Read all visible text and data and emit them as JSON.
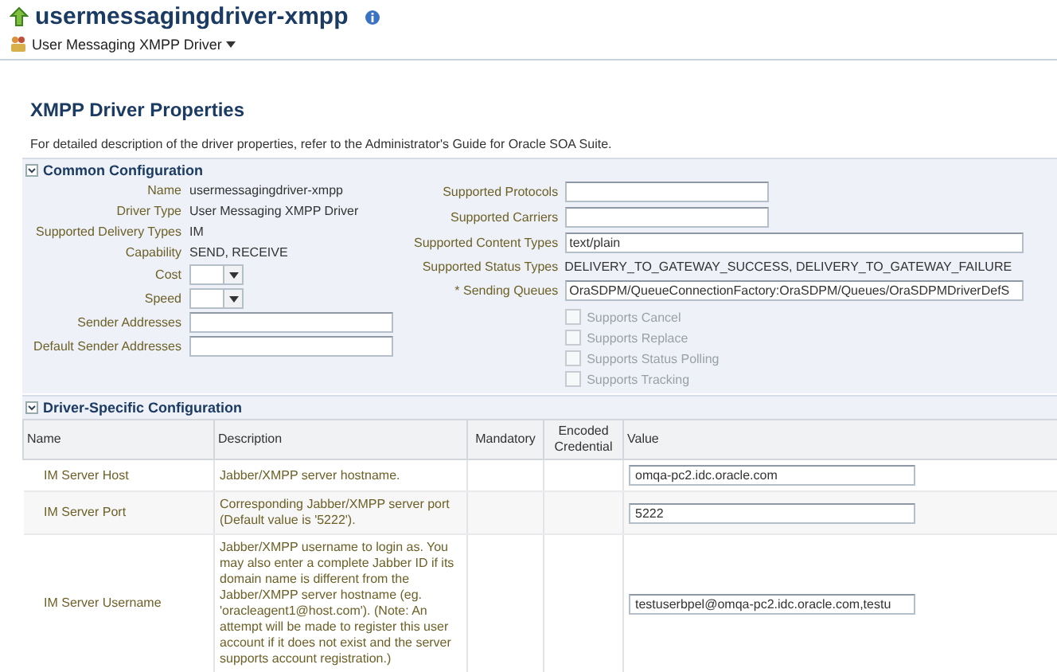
{
  "page": {
    "title": "usermessagingdriver-xmpp",
    "menu": "User Messaging XMPP Driver"
  },
  "heading": "XMPP Driver Properties",
  "description": "For detailed description of the driver properties, refer to the Administrator's Guide for Oracle SOA Suite.",
  "common": {
    "title": "Common Configuration",
    "expanded": true,
    "left": [
      {
        "kind": "text",
        "label": "Name",
        "value": "usermessagingdriver-xmpp"
      },
      {
        "kind": "text",
        "label": "Driver Type",
        "value": "User Messaging XMPP Driver"
      },
      {
        "kind": "text",
        "label": "Supported Delivery Types",
        "value": "IM"
      },
      {
        "kind": "text",
        "label": "Capability",
        "value": "SEND, RECEIVE"
      },
      {
        "kind": "select",
        "label": "Cost"
      },
      {
        "kind": "select",
        "label": "Speed"
      },
      {
        "kind": "input",
        "label": "Sender Addresses"
      },
      {
        "kind": "input",
        "label": "Default Sender Addresses"
      }
    ],
    "right": [
      {
        "kind": "input",
        "label": "Supported Protocols"
      },
      {
        "kind": "input",
        "label": "Supported Carriers"
      },
      {
        "kind": "wide",
        "label": "Supported Content Types",
        "value": "text/plain"
      },
      {
        "kind": "text",
        "label": "Supported Status Types",
        "value": "DELIVERY_TO_GATEWAY_SUCCESS, DELIVERY_TO_GATEWAY_FAILURE"
      },
      {
        "kind": "wide",
        "label": "* Sending Queues",
        "value": "OraSDPM/QueueConnectionFactory:OraSDPM/Queues/OraSDPMDriverDefS"
      }
    ],
    "checkboxes": [
      {
        "label": "Supports Cancel",
        "checked": false,
        "disabled": true
      },
      {
        "label": "Supports Replace",
        "checked": false,
        "disabled": true
      },
      {
        "label": "Supports Status Polling",
        "checked": false,
        "disabled": true
      },
      {
        "label": "Supports Tracking",
        "checked": false,
        "disabled": true
      }
    ]
  },
  "driver": {
    "title": "Driver-Specific Configuration",
    "expanded": true,
    "columns": [
      "Name",
      "Description",
      "Mandatory",
      "Encoded Credential",
      "Value"
    ],
    "rows": [
      {
        "name": "IM Server Host",
        "description": "Jabber/XMPP server hostname.",
        "value": "omqa-pc2.idc.oracle.com"
      },
      {
        "name": "IM Server Port",
        "description": "Corresponding Jabber/XMPP server port (Default value is '5222').",
        "value": "5222"
      },
      {
        "name": "IM Server Username",
        "description": "Jabber/XMPP username to login as. You may also enter a complete Jabber ID if its domain name is different from the Jabber/XMPP server hostname (eg. 'oracleagent1@host.com'). (Note: An attempt will be made to register this user account if it does not exist and the server supports account registration.)",
        "value": "testuserbpel@omqa-pc2.idc.oracle.com,testu"
      }
    ]
  }
}
